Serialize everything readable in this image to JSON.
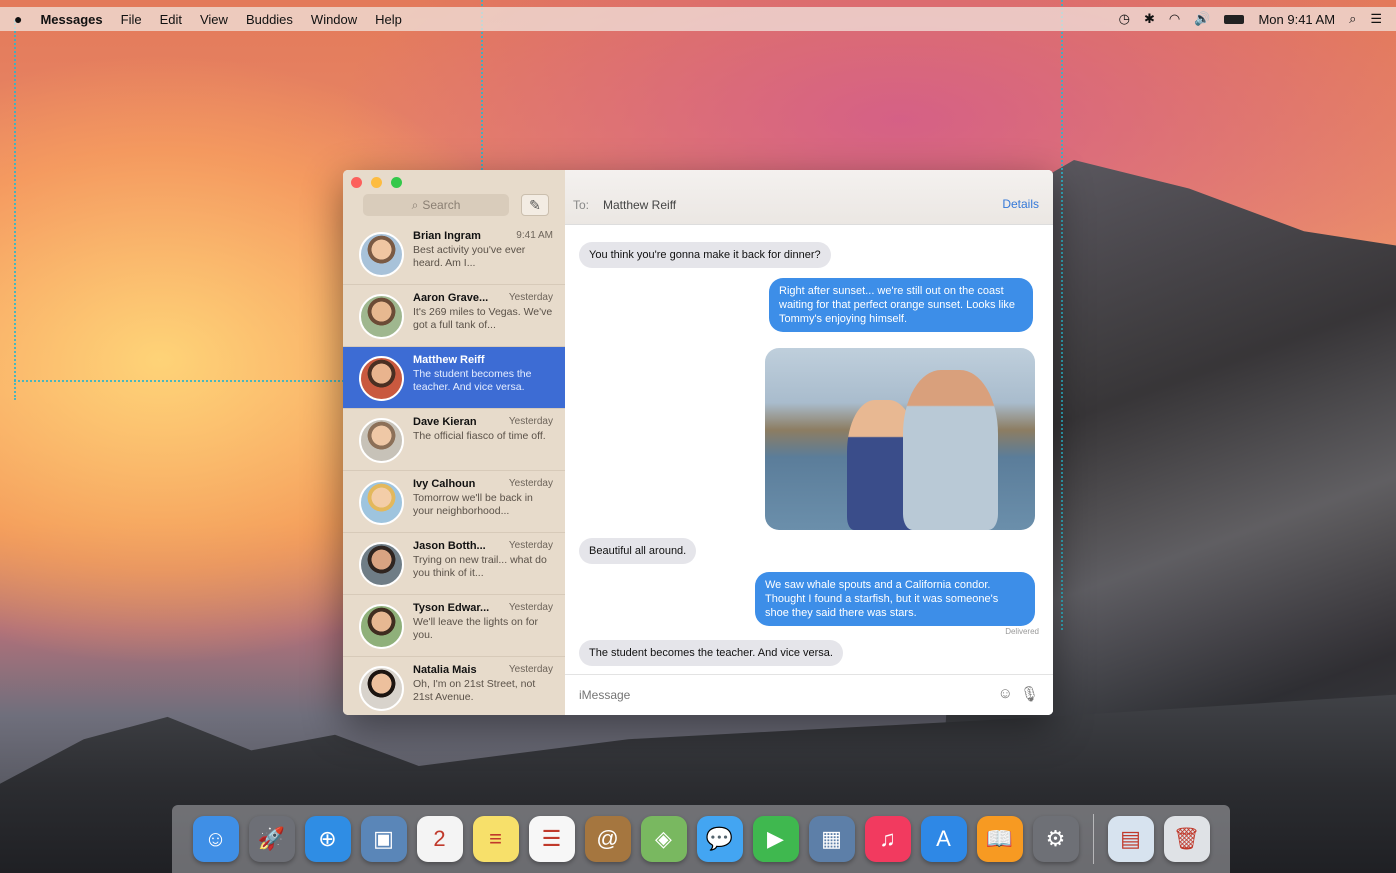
{
  "menubar": {
    "apple_icon": "apple-icon",
    "app_name": "Messages",
    "menus": [
      "File",
      "Edit",
      "View",
      "Buddies",
      "Window",
      "Help"
    ],
    "clock": "Mon 9:41 AM",
    "status_icons": [
      "time-machine-icon",
      "bluetooth-icon",
      "wifi-icon",
      "volume-icon",
      "battery-icon",
      "spotlight-icon",
      "notification-center-icon"
    ]
  },
  "sidebar": {
    "search_placeholder": "Search",
    "conversations": [
      {
        "name": "Brian Ingram",
        "time": "9:41 AM",
        "preview": "Best activity you've ever heard. Am I..."
      },
      {
        "name": "Aaron Grave...",
        "time": "Yesterday",
        "preview": "It's 269 miles to Vegas. We've got a full tank of..."
      },
      {
        "name": "Matthew Reiff",
        "time": "",
        "preview": "The student becomes the teacher. And vice versa."
      },
      {
        "name": "Dave Kieran",
        "time": "Yesterday",
        "preview": "The official fiasco of time off."
      },
      {
        "name": "Ivy Calhoun",
        "time": "Yesterday",
        "preview": "Tomorrow we'll be back in your neighborhood..."
      },
      {
        "name": "Jason Botth...",
        "time": "Yesterday",
        "preview": "Trying on new trail... what do you think of it..."
      },
      {
        "name": "Tyson Edwar...",
        "time": "Yesterday",
        "preview": "We'll leave the lights on for you."
      },
      {
        "name": "Natalia Mais",
        "time": "Yesterday",
        "preview": "Oh, I'm on 21st Street, not 21st Avenue."
      }
    ]
  },
  "chat": {
    "to_label": "To:",
    "to_name": "Matthew Reiff",
    "details_label": "Details",
    "messages": [
      {
        "dir": "in",
        "text": "You think you're gonna make it back for dinner?"
      },
      {
        "dir": "out",
        "text": "Right after sunset... we're still out on the coast waiting for that perfect orange sunset. Looks like Tommy's enjoying himself."
      },
      {
        "dir": "in",
        "text": "Beautiful all around."
      },
      {
        "dir": "out",
        "text": "We saw whale spouts and a California condor. Thought I found a starfish, but it was someone's shoe they said there was stars."
      },
      {
        "dir": "in",
        "text": "The student becomes the teacher. And vice versa."
      }
    ],
    "delivered": "Delivered",
    "input_placeholder": "iMessage"
  },
  "dock": {
    "apps": [
      {
        "name": "finder-icon",
        "color": "#3f8fe6",
        "glyph": "☺"
      },
      {
        "name": "launchpad-icon",
        "color": "#6d6f76",
        "glyph": "🚀"
      },
      {
        "name": "safari-icon",
        "color": "#2f8de4",
        "glyph": "⊕"
      },
      {
        "name": "preview-icon",
        "color": "#5a86b8",
        "glyph": "▣"
      },
      {
        "name": "calendar-icon",
        "color": "#f4f4f4",
        "glyph": "2"
      },
      {
        "name": "notes-icon",
        "color": "#f7e06a",
        "glyph": "≡"
      },
      {
        "name": "reminders-icon",
        "color": "#f7f7f7",
        "glyph": "☰"
      },
      {
        "name": "contacts-icon",
        "color": "#a5763f",
        "glyph": "@"
      },
      {
        "name": "maps-icon",
        "color": "#79b860",
        "glyph": "◈"
      },
      {
        "name": "messages-icon",
        "color": "#43a5f2",
        "glyph": "💬"
      },
      {
        "name": "facetime-icon",
        "color": "#3fb84f",
        "glyph": "▶"
      },
      {
        "name": "photo-booth-icon",
        "color": "#5d7fa8",
        "glyph": "▦"
      },
      {
        "name": "itunes-icon",
        "color": "#f23a5f",
        "glyph": "♫"
      },
      {
        "name": "app-store-icon",
        "color": "#2e88e6",
        "glyph": "A"
      },
      {
        "name": "ibooks-icon",
        "color": "#f79a22",
        "glyph": "📖"
      },
      {
        "name": "system-preferences-icon",
        "color": "#6e7076",
        "glyph": "⚙"
      }
    ],
    "extras": [
      {
        "name": "documents-folder-icon",
        "color": "#d7e3ef",
        "glyph": "▤"
      },
      {
        "name": "trash-icon",
        "color": "#dfe2e6",
        "glyph": "🗑"
      }
    ]
  }
}
